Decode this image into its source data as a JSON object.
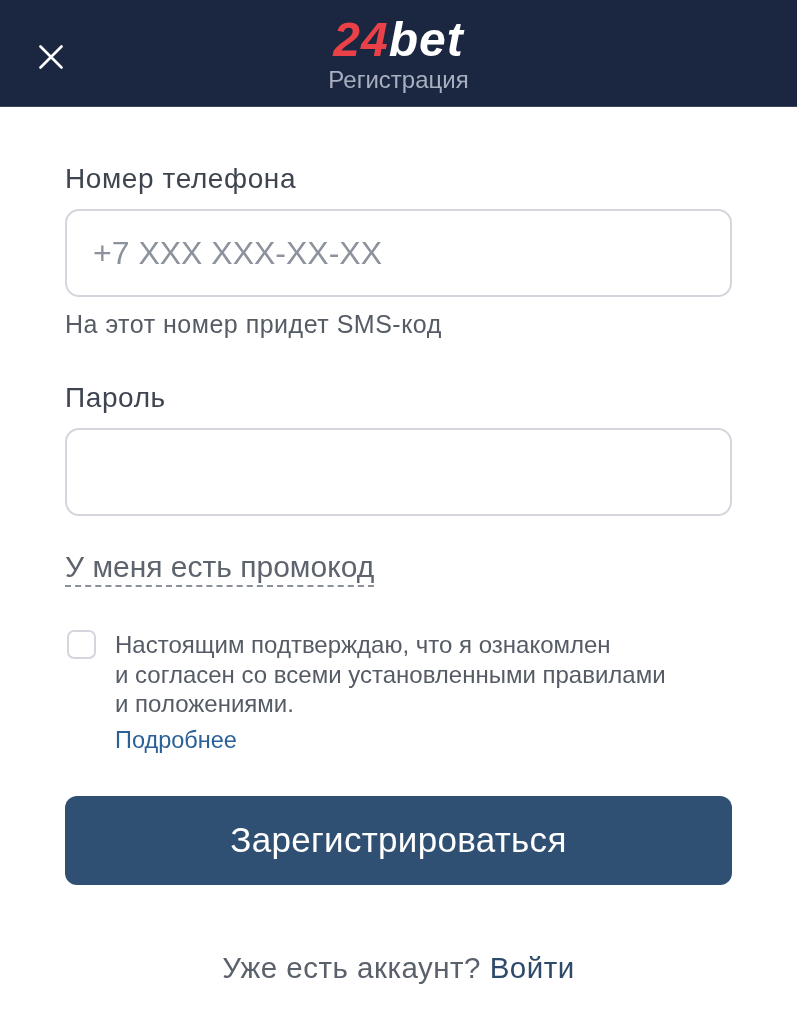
{
  "header": {
    "logo": {
      "accent": "24",
      "rest": "bet"
    },
    "title": "Регистрация"
  },
  "fields": [
    {
      "label": "Номер телефона",
      "placeholder": "+7 XXX XXX-XX-XX",
      "hint": "На этот номер придет SMS-код"
    },
    {
      "label": "Пароль"
    }
  ],
  "promo_link": "У меня есть промокод",
  "terms": {
    "checked": false,
    "text": "Настоящим подтверждаю, что я ознакомлен\nи согласен со всеми установленными правилами\nи положениями.",
    "link": "Подробнее"
  },
  "submit_button": "Зарегистрироваться",
  "footer": {
    "text": "Уже есть аккаунт?",
    "link": "Войти"
  }
}
